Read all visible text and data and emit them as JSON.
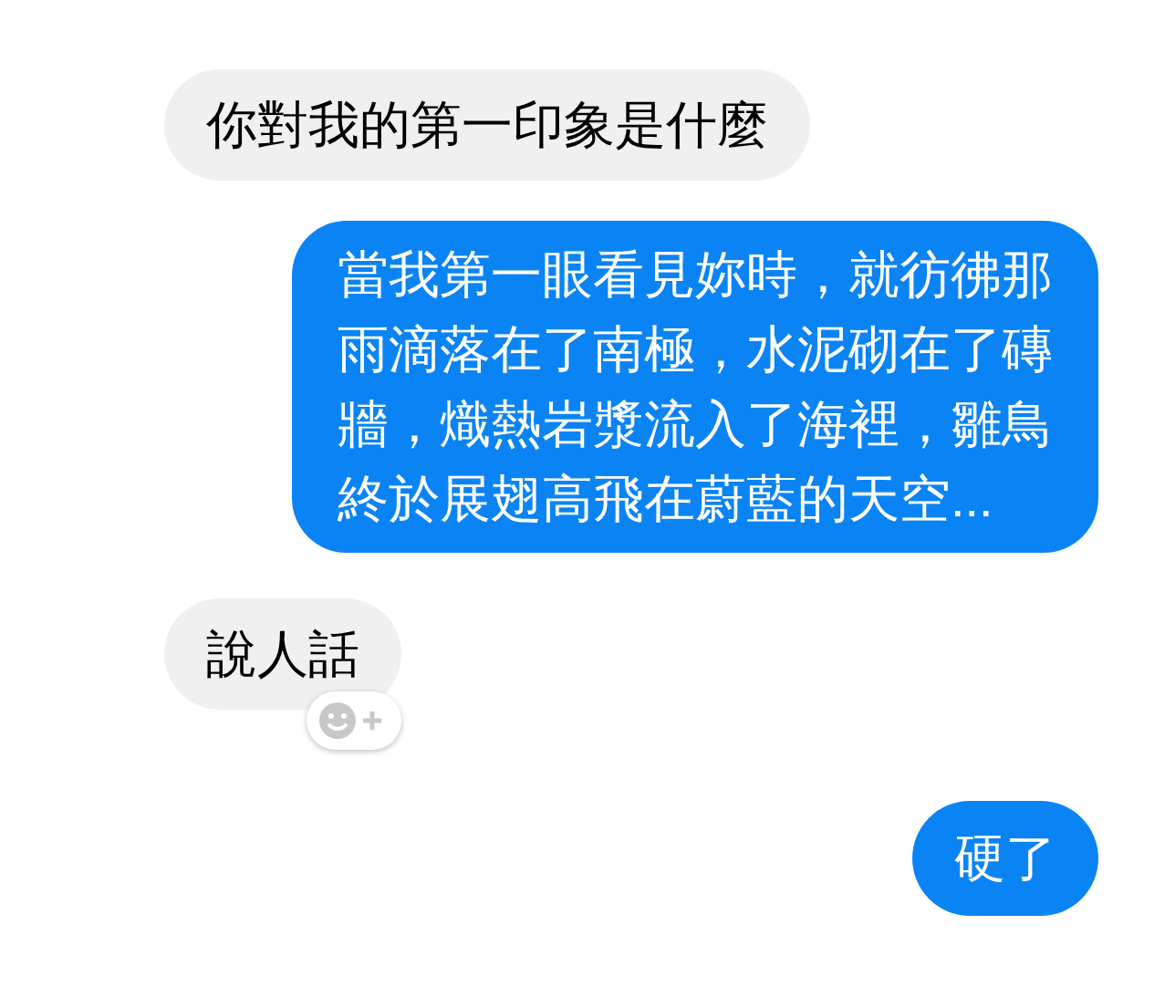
{
  "messages": [
    {
      "kind": "incoming",
      "text": "你對我的第一印象是什麼",
      "reaction_button": false
    },
    {
      "kind": "outgoing",
      "text": "當我第一眼看見妳時，就彷彿那雨滴落在了南極，水泥砌在了磚牆，熾熱岩漿流入了海裡，雛鳥終於展翅高飛在蔚藍的天空...",
      "reaction_button": false
    },
    {
      "kind": "incoming",
      "text": "說人話",
      "reaction_button": true
    },
    {
      "kind": "outgoing",
      "text": "硬了",
      "reaction_button": false
    }
  ]
}
